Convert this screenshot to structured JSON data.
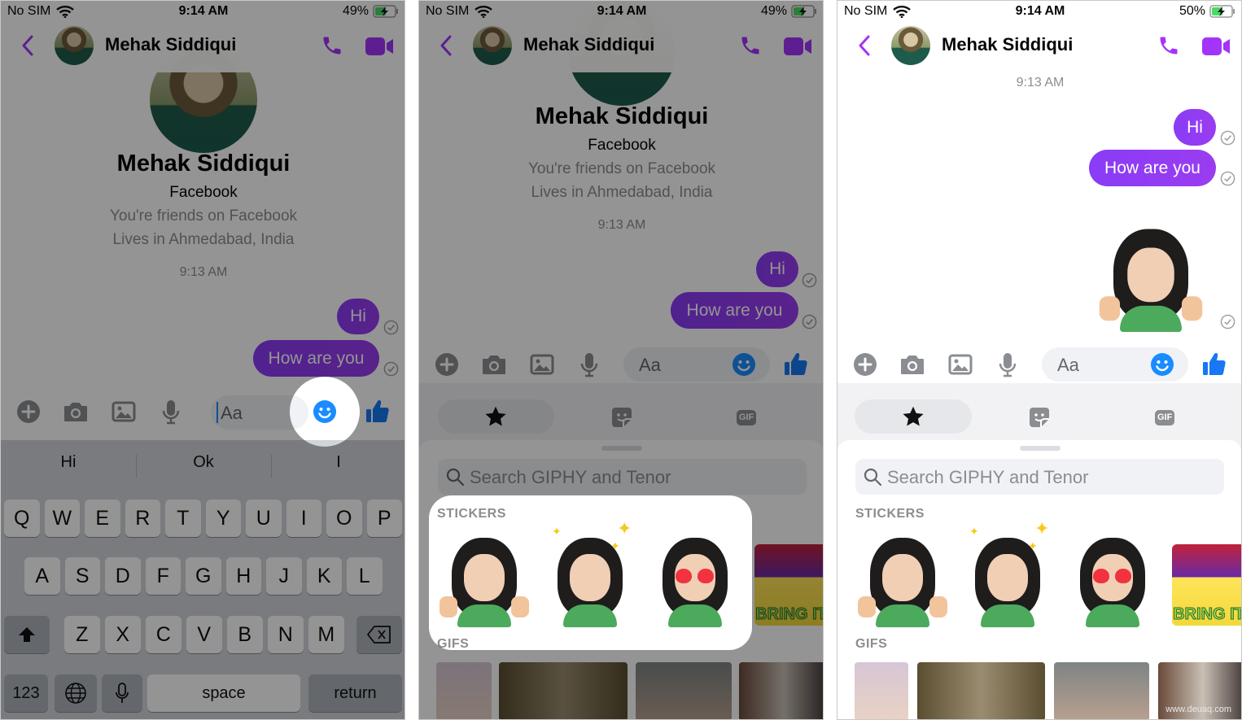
{
  "panels": [
    {
      "status": {
        "carrier": "No SIM",
        "time": "9:14 AM",
        "battery": "49%"
      },
      "header": {
        "name": "Mehak Siddiqui"
      },
      "profile": {
        "name": "Mehak Siddiqui",
        "source": "Facebook",
        "friends": "You're friends on Facebook",
        "location": "Lives in Ahmedabad, India"
      },
      "timestamp": "9:13 AM",
      "messages": [
        "Hi",
        "How are you"
      ],
      "composer": {
        "placeholder": "Aa"
      },
      "suggestions": [
        "Hi",
        "Ok",
        "I"
      ],
      "keyboard": {
        "rows": [
          [
            "Q",
            "W",
            "E",
            "R",
            "T",
            "Y",
            "U",
            "I",
            "O",
            "P"
          ],
          [
            "A",
            "S",
            "D",
            "F",
            "G",
            "H",
            "J",
            "K",
            "L"
          ],
          [
            "Z",
            "X",
            "C",
            "V",
            "B",
            "N",
            "M"
          ]
        ],
        "numbers": "123",
        "space": "space",
        "return": "return"
      },
      "highlight": "emoji-button"
    },
    {
      "status": {
        "carrier": "No SIM",
        "time": "9:14 AM",
        "battery": "49%"
      },
      "header": {
        "name": "Mehak Siddiqui"
      },
      "profile": {
        "name": "Mehak Siddiqui",
        "source": "Facebook",
        "friends": "You're friends on Facebook",
        "location": "Lives in Ahmedabad, India"
      },
      "timestamp": "9:13 AM",
      "messages": [
        "Hi",
        "How are you"
      ],
      "composer": {
        "placeholder": "Aa"
      },
      "tabs": {
        "gif": "GIF",
        "active": "favorites"
      },
      "search": {
        "placeholder": "Search GIPHY and Tenor"
      },
      "sections": {
        "stickers": "STICKERS",
        "gifs": "GIFS"
      },
      "sticker_text": "BRING IT",
      "highlight": "stickers-section"
    },
    {
      "status": {
        "carrier": "No SIM",
        "time": "9:14 AM",
        "battery": "50%"
      },
      "header": {
        "name": "Mehak Siddiqui"
      },
      "timestamp": "9:13 AM",
      "messages": [
        "Hi",
        "How are you"
      ],
      "composer": {
        "placeholder": "Aa"
      },
      "tabs": {
        "gif": "GIF",
        "active": "favorites"
      },
      "search": {
        "placeholder": "Search GIPHY and Tenor"
      },
      "sections": {
        "stickers": "STICKERS",
        "gifs": "GIFS"
      },
      "sticker_text": "BRING IT",
      "watermark": "www.deuaq.com"
    }
  ],
  "colors": {
    "accent": "#a334fa",
    "bubble": "#8e3cf5",
    "emoji": "#1a8cff",
    "like": "#1877f2"
  }
}
